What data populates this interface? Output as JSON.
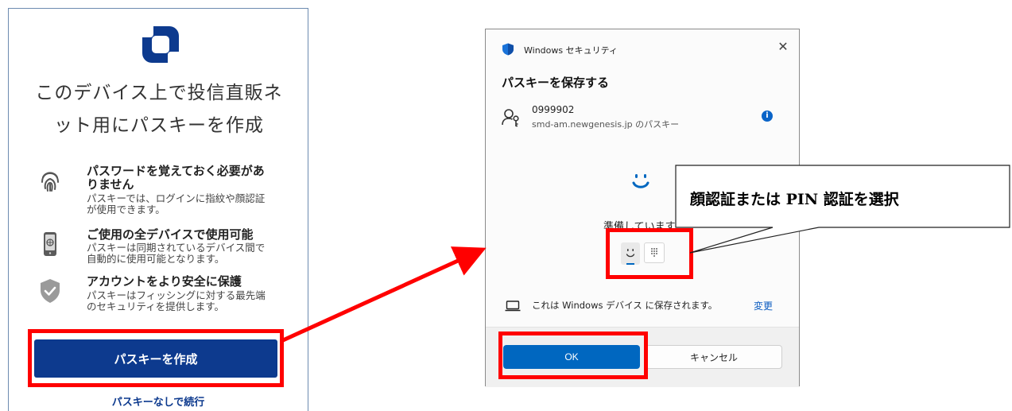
{
  "left_panel": {
    "title_line1": "このデバイス上で投信直販ネ",
    "title_line2": "ット用にパスキーを作成",
    "features": [
      {
        "icon": "fingerprint-icon",
        "heading_line1": "パスワードを覚えておく必要があ",
        "heading_line2": "りません",
        "desc_line1": "パスキーでは、ログインに指紋や顔認証",
        "desc_line2": "が使用できます。"
      },
      {
        "icon": "phone-icon",
        "heading_line1": "ご使用の全デバイスで使用可能",
        "desc_line1": "パスキーは同期されているデバイス間で",
        "desc_line2": "自動的に使用可能となります。"
      },
      {
        "icon": "shield-check-icon",
        "heading_line1": "アカウントをより安全に保護",
        "desc_line1": "パスキーはフィッシングに対する最先端",
        "desc_line2": "のセキュリティを提供します。"
      }
    ],
    "create_button": "パスキーを作成",
    "continue_link": "パスキーなしで続行"
  },
  "dialog": {
    "app_name": "Windows セキュリティ",
    "close": "✕",
    "heading": "パスキーを保存する",
    "account_id": "0999902",
    "account_site": "smd-am.newgenesis.jp のパスキー",
    "info": "i",
    "status": "準備しています...",
    "save_note": "これは Windows デバイス に保存されます。",
    "change_link": "変更",
    "ok_button": "OK",
    "cancel_button": "キャンセル"
  },
  "annotation": {
    "callout": "顔認証または PIN 認証を選択",
    "highlight_color": "#ff0000"
  },
  "colors": {
    "primary_blue": "#0d3a8e",
    "windows_accent": "#0067c0"
  }
}
